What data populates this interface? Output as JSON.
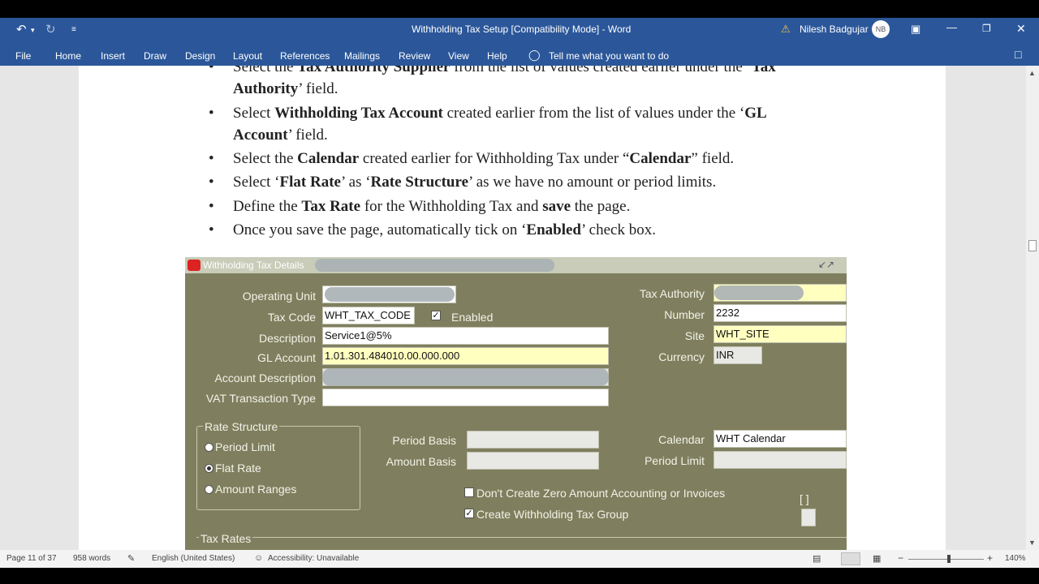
{
  "window": {
    "title": "Withholding Tax Setup [Compatibility Mode]  -  Word",
    "user": "Nilesh Badgujar",
    "user_initials": "NB"
  },
  "ribbon": {
    "tabs": [
      "File",
      "Home",
      "Insert",
      "Draw",
      "Design",
      "Layout",
      "References",
      "Mailings",
      "Review",
      "View",
      "Help"
    ],
    "tell_me": "Tell me what you want to do"
  },
  "doc": {
    "bullets": [
      {
        "parts": [
          {
            "t": "Select the ",
            "b": false
          },
          {
            "t": "Tax Authority Supplier",
            "b": true
          },
          {
            "t": " from the list of values created earlier under the ‘",
            "b": false
          },
          {
            "t": "Tax",
            "b": true
          }
        ]
      },
      {
        "parts": [
          {
            "t": "Authority",
            "b": true
          },
          {
            "t": "’ field.",
            "b": false
          }
        ]
      },
      {
        "parts": [
          {
            "t": "Select ",
            "b": false
          },
          {
            "t": "Withholding Tax Account",
            "b": true
          },
          {
            "t": " created earlier from the list of values under the ‘",
            "b": false
          },
          {
            "t": "GL",
            "b": true
          }
        ]
      },
      {
        "parts": [
          {
            "t": "Account",
            "b": true
          },
          {
            "t": "’ field.",
            "b": false
          }
        ]
      },
      {
        "parts": [
          {
            "t": "Select the ",
            "b": false
          },
          {
            "t": "Calendar",
            "b": true
          },
          {
            "t": " created earlier for Withholding Tax under “",
            "b": false
          },
          {
            "t": "Calendar",
            "b": true
          },
          {
            "t": "” field.",
            "b": false
          }
        ]
      },
      {
        "parts": [
          {
            "t": "Select ‘",
            "b": false
          },
          {
            "t": "Flat Rate",
            "b": true
          },
          {
            "t": "’ as ‘",
            "b": false
          },
          {
            "t": "Rate Structure",
            "b": true
          },
          {
            "t": "’ as we have no amount or period limits.",
            "b": false
          }
        ]
      },
      {
        "parts": [
          {
            "t": "Define the ",
            "b": false
          },
          {
            "t": "Tax Rate",
            "b": true
          },
          {
            "t": " for the Withholding Tax and ",
            "b": false
          },
          {
            "t": "save",
            "b": true
          },
          {
            "t": " the page.",
            "b": false
          }
        ]
      },
      {
        "parts": [
          {
            "t": "Once you save the page, automatically tick on ‘",
            "b": false
          },
          {
            "t": "Enabled",
            "b": true
          },
          {
            "t": "’ check box.",
            "b": false
          }
        ]
      }
    ]
  },
  "oracle_form": {
    "title": "Withholding Tax Details",
    "labels": {
      "operating_unit": "Operating Unit",
      "tax_code": "Tax Code",
      "enabled": "Enabled",
      "description": "Description",
      "gl_account": "GL Account",
      "account_description": "Account Description",
      "vat_transaction_type": "VAT Transaction Type",
      "tax_authority": "Tax Authority",
      "number": "Number",
      "site": "Site",
      "currency": "Currency",
      "rate_structure": "Rate Structure",
      "period_limit_radio": "Period Limit",
      "flat_rate_radio": "Flat Rate",
      "amount_ranges_radio": "Amount Ranges",
      "period_basis": "Period Basis",
      "amount_basis": "Amount Basis",
      "calendar": "Calendar",
      "period_limit": "Period Limit",
      "dont_create_zero": "Don't Create Zero Amount Accounting or Invoices",
      "create_group": "Create Withholding Tax Group",
      "tax_rates": "Tax Rates",
      "bracket": "[ ]"
    },
    "values": {
      "tax_code": "WHT_TAX_CODE",
      "description": "Service1@5%",
      "gl_account": "1.01.301.484010.00.000.000",
      "number": "2232",
      "site": "WHT_SITE",
      "currency": "INR",
      "calendar": "WHT Calendar"
    },
    "enabled_checked": true,
    "create_group_checked": true,
    "dont_create_zero_checked": false,
    "rate_structure_selected": "flat_rate"
  },
  "status": {
    "page": "Page 11 of 37",
    "words": "958 words",
    "language": "English (United States)",
    "accessibility": "Accessibility: Unavailable",
    "zoom": "140%"
  }
}
